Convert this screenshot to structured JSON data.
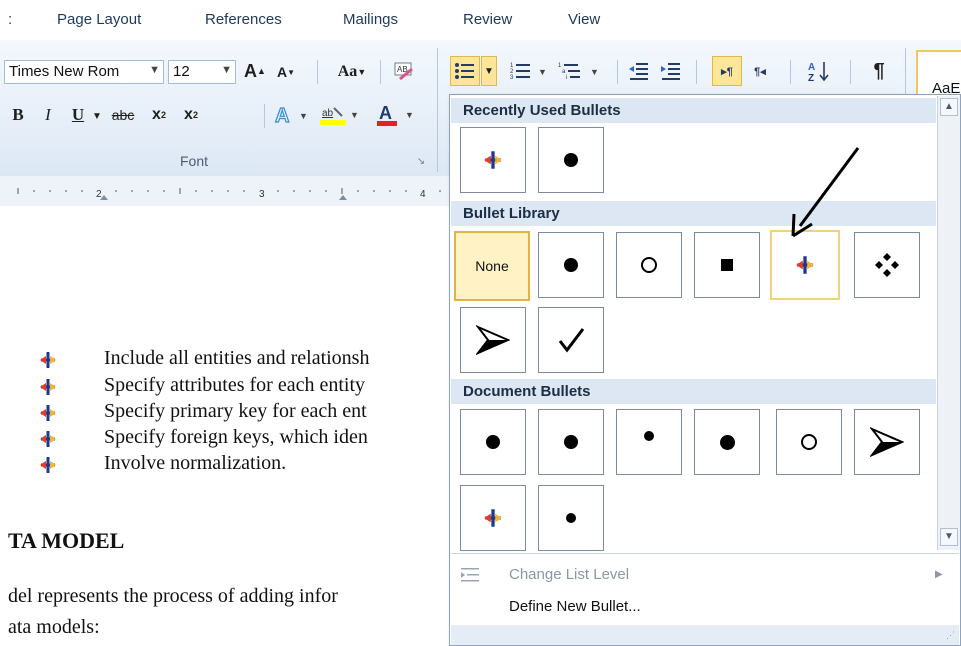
{
  "ribbon": {
    "tabs": [
      "Page Layout",
      "References",
      "Mailings",
      "Review",
      "View"
    ],
    "font_name": "Times New Rom",
    "font_size": "12",
    "font_group_label": "Font",
    "style_preview": "AaE"
  },
  "ruler": {
    "marks": [
      "2",
      "3",
      "4"
    ]
  },
  "document": {
    "bullet_lines": [
      "Include all entities and relationsh",
      "Specify attributes for each entity",
      "Specify primary key for each ent",
      "Specify foreign keys, which iden",
      "Involve normalization."
    ],
    "heading": "TA MODEL",
    "para_lines": [
      "del represents the process of adding infor",
      "ata models:"
    ]
  },
  "dropdown": {
    "recently_used_title": "Recently Used Bullets",
    "library_title": "Bullet Library",
    "none_label": "None",
    "document_title": "Document Bullets",
    "change_list_level": "Change List Level",
    "define_new_bullet": "Define New Bullet..."
  },
  "colors": {
    "accent_highlight": "#fde59a",
    "section_bg": "#dde7f3",
    "tab_text": "#1e395b"
  }
}
